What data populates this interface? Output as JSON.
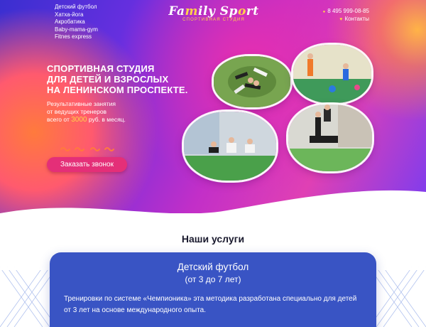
{
  "nav": {
    "items": [
      "Детский футбол",
      "Хатха-йога",
      "Акробатика",
      "Baby-mama-gym",
      "Fitnes express"
    ]
  },
  "logo": {
    "title_part1": "Fa",
    "title_accent1": "m",
    "title_part2": "ily Sp",
    "title_accent2": "o",
    "title_part3": "rt",
    "subtitle": "СПОРТИВНАЯ СТУДИЯ"
  },
  "header": {
    "phone": "8 495 999-08-85",
    "contacts_label": "Контакты"
  },
  "hero": {
    "headline_line1": "СПОРТИВНАЯ СТУДИЯ",
    "headline_line2": "ДЛЯ ДЕТЕЙ И ВЗРОСЛЫХ",
    "headline_line3": "НА ЛЕНИНСКОМ ПРОСПЕКТЕ.",
    "sub_line1": "Результативные занятия",
    "sub_line2": "от ведущих тренеров",
    "sub_line3_prefix": "всего от ",
    "sub_price": "3000",
    "sub_line3_suffix": " руб. в месяц.",
    "cta_label": "Заказать звонок"
  },
  "services": {
    "title": "Наши услуги",
    "card": {
      "title": "Детский футбол",
      "age": "(от 3 до 7 лет)",
      "description": "Тренировки по системе «Чемпионика» эта методика разработана специально для детей от 3 лет на основе международного опыта."
    }
  },
  "colors": {
    "accent_yellow": "#ffd34a",
    "cta_pink": "#e42f78",
    "card_blue": "#3954c4"
  },
  "icons": {
    "phone": "phone-icon",
    "contacts": "heart-icon"
  }
}
